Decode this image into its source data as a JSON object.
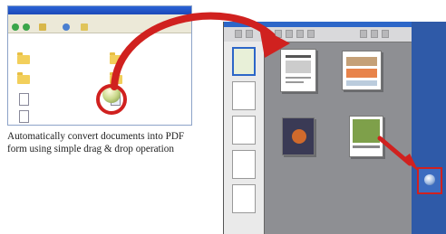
{
  "caption": "Automatically convert documents into PDF form using simple drag & drop operation",
  "colors": {
    "arrow": "#d0211f",
    "desktop": "#2f5aa8",
    "titlebar": "#2a63d6"
  },
  "icons": [
    "folder-icon",
    "document-icon",
    "pdf-document-icon",
    "drag-arrow-icon",
    "desktop-shortcut-icon"
  ]
}
